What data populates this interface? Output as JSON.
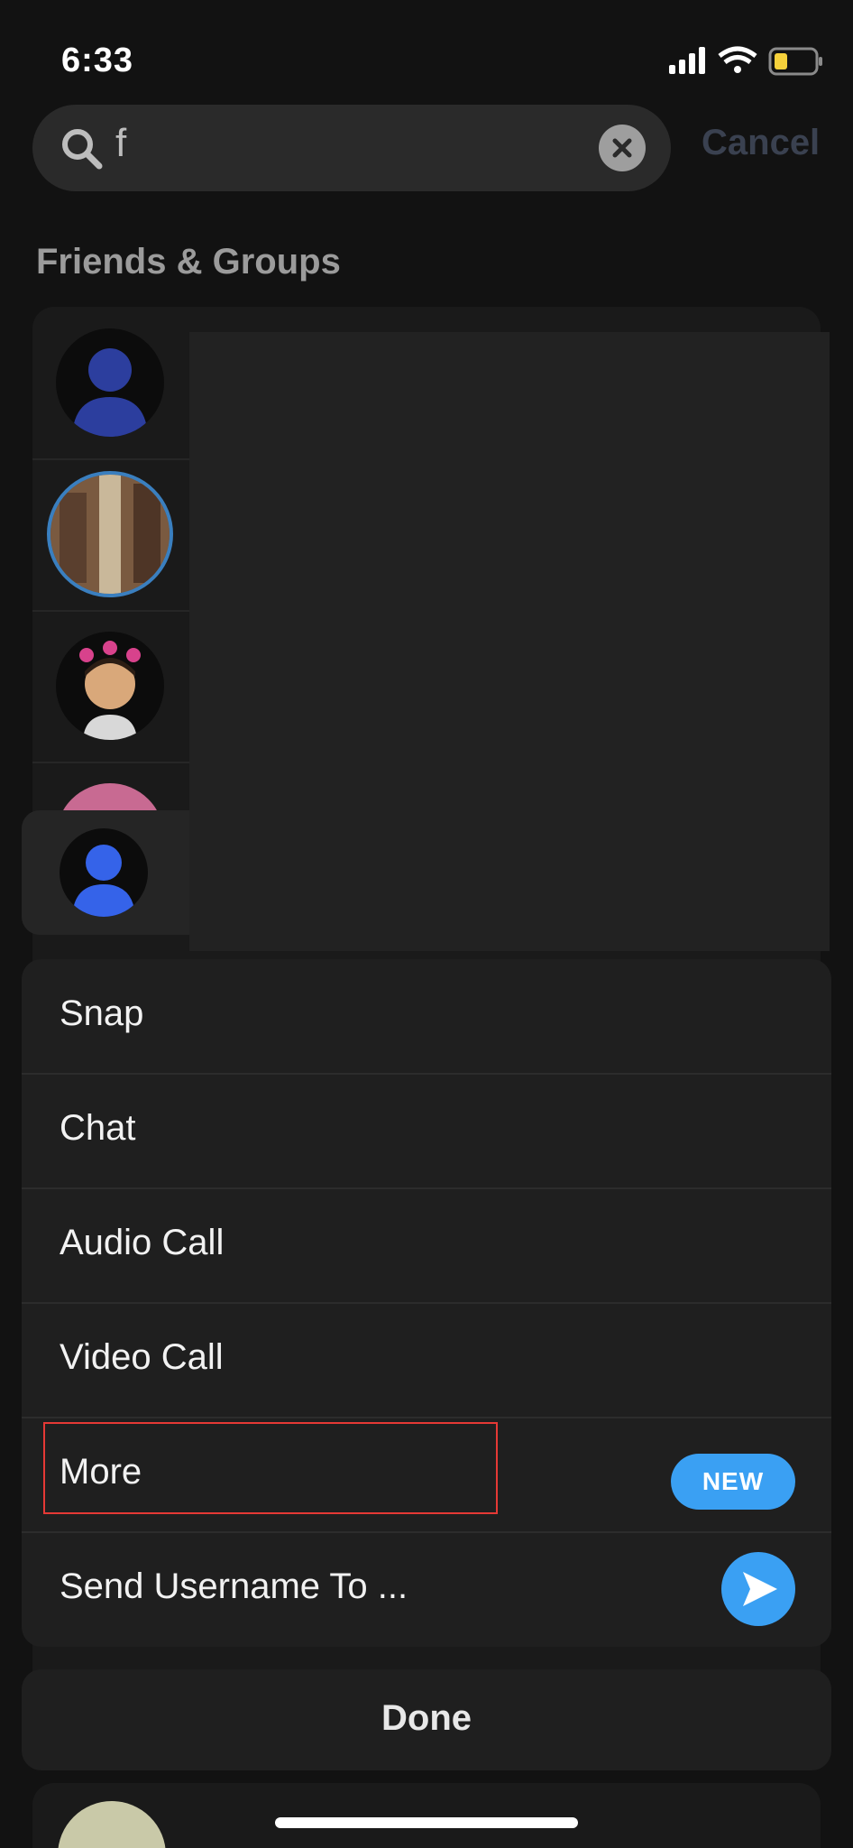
{
  "status_bar": {
    "time": "6:33"
  },
  "search": {
    "query": "f",
    "cancel_label": "Cancel"
  },
  "section": {
    "title": "Friends & Groups"
  },
  "action_sheet": {
    "items": [
      {
        "label": "Snap"
      },
      {
        "label": "Chat"
      },
      {
        "label": "Audio Call"
      },
      {
        "label": "Video Call"
      },
      {
        "label": "More",
        "badge": "NEW"
      },
      {
        "label": "Send Username To ..."
      }
    ]
  },
  "done": {
    "label": "Done"
  },
  "colors": {
    "accent": "#3aa0f3",
    "highlight": "#e53935"
  }
}
